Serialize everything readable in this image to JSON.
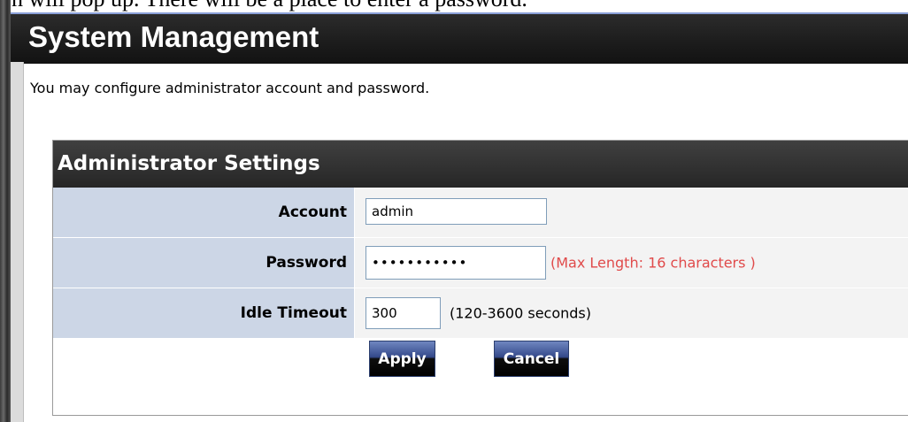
{
  "doc_text": "on will pop up. There will be a place to enter a password.",
  "page": {
    "title": "System Management",
    "description": "You may configure administrator account and password."
  },
  "settings": {
    "title": "Administrator Settings",
    "account": {
      "label": "Account",
      "value": "admin"
    },
    "password": {
      "label": "Password",
      "value": "passwordxxx",
      "hint": "(Max Length: 16 characters )"
    },
    "idle_timeout": {
      "label": "Idle Timeout",
      "value": "300",
      "hint": "(120-3600 seconds)"
    }
  },
  "buttons": {
    "apply": "Apply",
    "cancel": "Cancel"
  },
  "colors": {
    "title_bar": "#1e1e1e",
    "label_cell": "#ccd6e6",
    "hint_red": "#e04a4a",
    "button": "#34498a"
  }
}
